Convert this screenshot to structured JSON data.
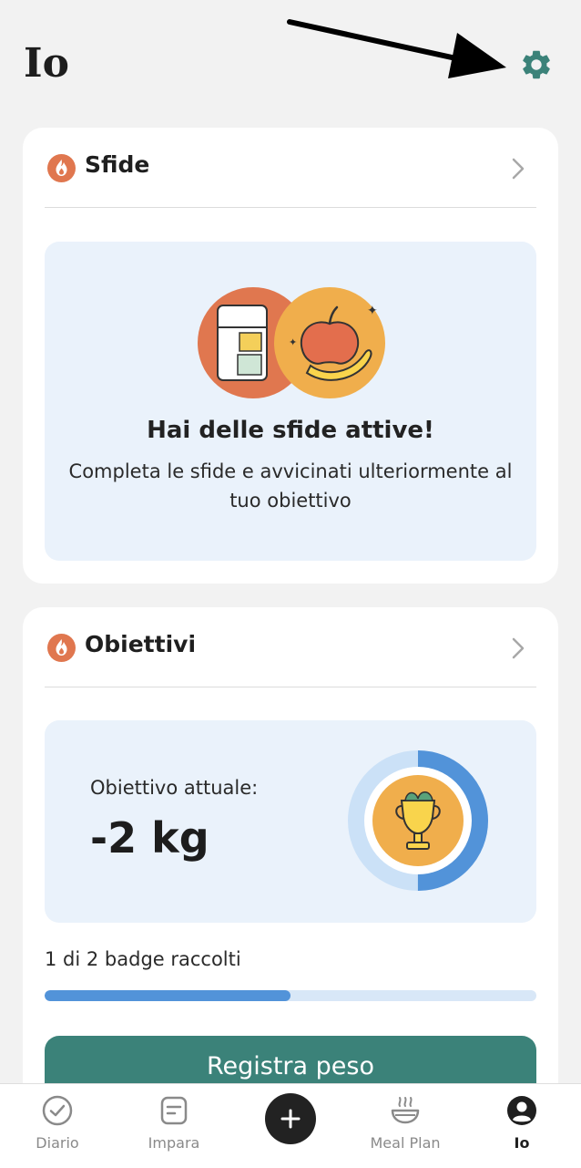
{
  "header": {
    "title": "Io"
  },
  "challenges": {
    "title": "Sfide",
    "panel_title": "Hai delle sfide attive!",
    "panel_text": "Completa le sfide e avvicinati ulteriormente al tuo obiettivo"
  },
  "goals": {
    "title": "Obiettivi",
    "current_label": "Obiettivo attuale:",
    "current_value": "-2 kg",
    "badges_text": "1 di 2 badge raccolti",
    "badges_collected": 1,
    "badges_total": 2,
    "button_label": "Registra peso"
  },
  "tabbar": {
    "items": [
      {
        "label": "Diario",
        "icon": "check-circle-icon"
      },
      {
        "label": "Impara",
        "icon": "document-icon"
      },
      {
        "label": "",
        "icon": "plus-icon"
      },
      {
        "label": "Meal Plan",
        "icon": "bowl-icon"
      },
      {
        "label": "Io",
        "icon": "profile-icon"
      }
    ],
    "active": "Io"
  },
  "colors": {
    "accent_teal": "#3b8279",
    "flame_orange": "#e0774f",
    "progress_blue": "#5293d9",
    "panel_blue": "#eaf2fb",
    "background": "#f2f2f2"
  }
}
